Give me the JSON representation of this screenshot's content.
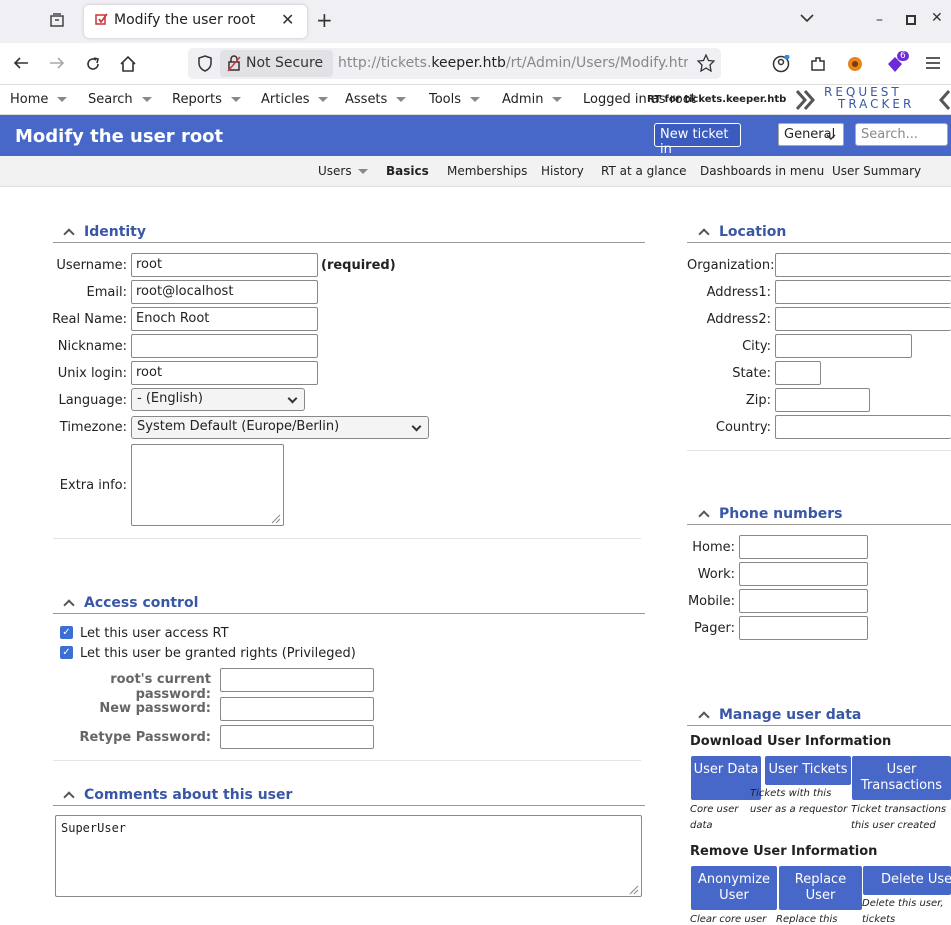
{
  "browser": {
    "tab_title": "Modify the user root",
    "not_secure": "Not Secure",
    "url_prefix": "http://tickets.",
    "url_host": "keeper.htb",
    "url_path": "/rt/Admin/Users/Modify.htm",
    "ext_badge": "6"
  },
  "menu": {
    "items": [
      "Home",
      "Search",
      "Reports",
      "Articles",
      "Assets",
      "Tools",
      "Admin"
    ],
    "logged_in": "Logged in as root",
    "rt_for": "RT for tickets.keeper.htb",
    "logo_line1": "REQUEST",
    "logo_line2": "TRACKER"
  },
  "header": {
    "title": "Modify the user root",
    "new_ticket": "New ticket in",
    "queue": "General",
    "search_placeholder": "Search..."
  },
  "subnav": [
    "Users",
    "Basics",
    "Memberships",
    "History",
    "RT at a glance",
    "Dashboards in menu",
    "User Summary"
  ],
  "identity": {
    "title": "Identity",
    "username_label": "Username:",
    "username": "root",
    "required": "(required)",
    "email_label": "Email:",
    "email": "root@localhost",
    "realname_label": "Real Name:",
    "realname": "Enoch Root",
    "nickname_label": "Nickname:",
    "unix_label": "Unix login:",
    "unix": "root",
    "language_label": "Language:",
    "language": "- (English)",
    "timezone_label": "Timezone:",
    "timezone": "System Default (Europe/Berlin)",
    "extra_label": "Extra info:"
  },
  "access": {
    "title": "Access control",
    "check1": "Let this user access RT",
    "check2": "Let this user be granted rights (Privileged)",
    "current_pw": "root's current password:",
    "new_pw": "New password:",
    "retype_pw": "Retype Password:"
  },
  "comments": {
    "title": "Comments about this user",
    "text": "SuperUser"
  },
  "location": {
    "title": "Location",
    "org": "Organization:",
    "addr1": "Address1:",
    "addr2": "Address2:",
    "city": "City:",
    "state": "State:",
    "zip": "Zip:",
    "country": "Country:"
  },
  "phones": {
    "title": "Phone numbers",
    "home": "Home:",
    "work": "Work:",
    "mobile": "Mobile:",
    "pager": "Pager:"
  },
  "manage": {
    "title": "Manage user data",
    "download_heading": "Download User Information",
    "btn_user_data": "User Data",
    "btn_user_tickets": "User Tickets",
    "btn_user_transactions": "User Transactions",
    "desc_core": "Core user data",
    "desc_tickets": "Tickets with this user as a requestor",
    "desc_transactions": "Ticket transactions this user created",
    "remove_heading": "Remove User Information",
    "btn_anonymize": "Anonymize User",
    "btn_replace": "Replace User",
    "btn_delete": "Delete User",
    "desc_clear": "Clear core user",
    "desc_replace": "Replace this",
    "desc_delete": "Delete this user, tickets associated"
  }
}
